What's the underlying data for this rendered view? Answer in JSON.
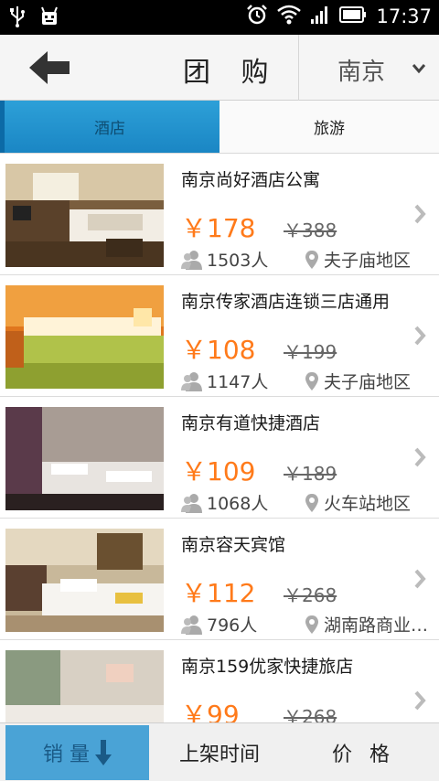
{
  "status_bar": {
    "time": "17:37"
  },
  "header": {
    "title": "团 购",
    "city": "南京"
  },
  "tabs": [
    {
      "label": "酒店",
      "active": true
    },
    {
      "label": "旅游",
      "active": false
    }
  ],
  "deals": [
    {
      "title": "南京尚好酒店公寓",
      "price": "￥178",
      "original_price": "￥388",
      "sales": "1503人",
      "area": "夫子庙地区"
    },
    {
      "title": "南京传家酒店连锁三店通用",
      "price": "￥108",
      "original_price": "￥199",
      "sales": "1147人",
      "area": "夫子庙地区"
    },
    {
      "title": "南京有道快捷酒店",
      "price": "￥109",
      "original_price": "￥189",
      "sales": "1068人",
      "area": "火车站地区"
    },
    {
      "title": "南京容天宾馆",
      "price": "￥112",
      "original_price": "￥268",
      "sales": "796人",
      "area": "湖南路商业…"
    },
    {
      "title": "南京159优家快捷旅店",
      "price": "￥99",
      "original_price": "￥268",
      "sales": "",
      "area": ""
    }
  ],
  "sort_bar": {
    "sales": "销 量",
    "time": "上架时间",
    "price": "价 格"
  },
  "colors": {
    "accent": "#2da0d8",
    "price": "#ff7a1a",
    "sort_active": "#4aa3d6"
  }
}
